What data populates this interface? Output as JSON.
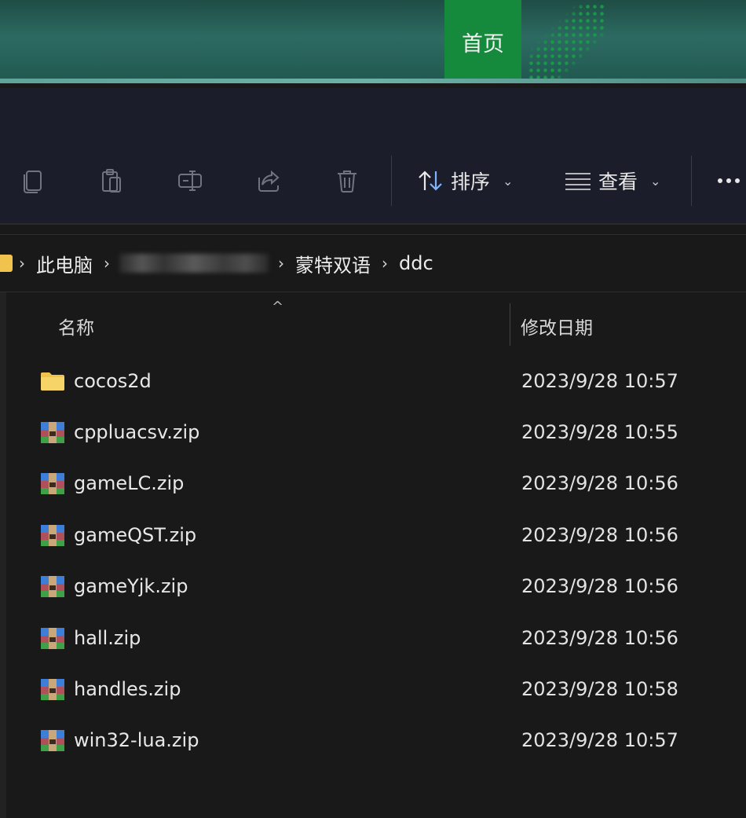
{
  "banner": {
    "home_tab": "首页"
  },
  "toolbar": {
    "icons": [
      "copy-icon",
      "paste-icon",
      "rename-icon",
      "share-icon",
      "delete-icon"
    ],
    "sort_label": "排序",
    "view_label": "查看"
  },
  "address": {
    "crumbs": [
      "此电脑",
      "蒙特双语",
      "ddc"
    ]
  },
  "columns": {
    "name": "名称",
    "modified": "修改日期"
  },
  "files": [
    {
      "name": "cocos2d",
      "date": "2023/9/28 10:57",
      "type": "folder"
    },
    {
      "name": "cppluacsv.zip",
      "date": "2023/9/28 10:55",
      "type": "zip"
    },
    {
      "name": "gameLC.zip",
      "date": "2023/9/28 10:56",
      "type": "zip"
    },
    {
      "name": "gameQST.zip",
      "date": "2023/9/28 10:56",
      "type": "zip"
    },
    {
      "name": "gameYjk.zip",
      "date": "2023/9/28 10:56",
      "type": "zip"
    },
    {
      "name": "hall.zip",
      "date": "2023/9/28 10:56",
      "type": "zip"
    },
    {
      "name": "handles.zip",
      "date": "2023/9/28 10:58",
      "type": "zip"
    },
    {
      "name": "win32-lua.zip",
      "date": "2023/9/28 10:57",
      "type": "zip"
    }
  ],
  "colors": {
    "folder": "#f0c44c",
    "accent_green": "#168a3c"
  }
}
